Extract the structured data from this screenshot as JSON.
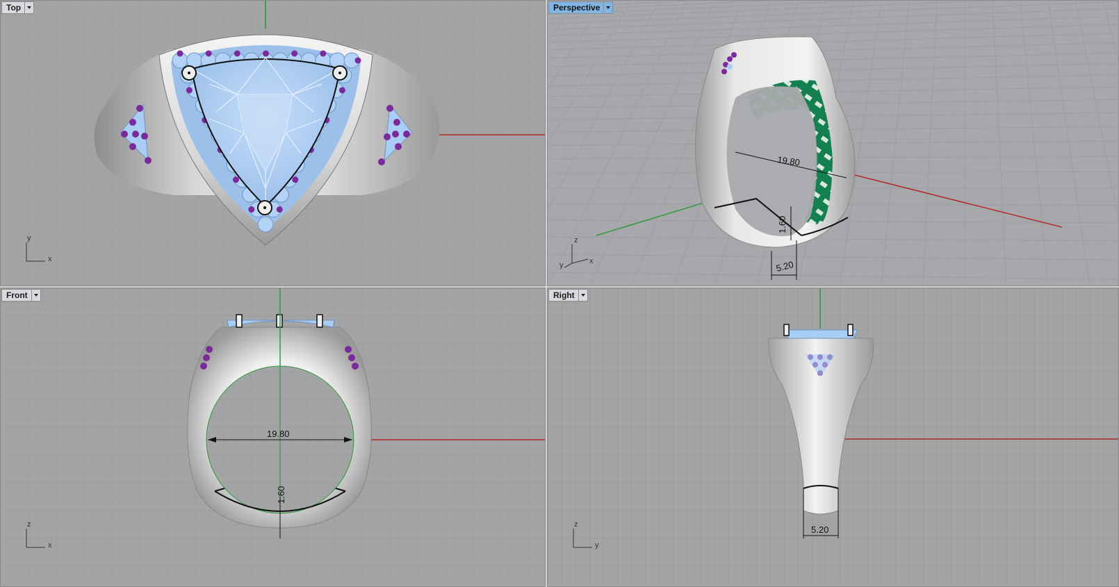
{
  "viewports": {
    "top": {
      "label": "Top",
      "axis_h": "x",
      "axis_v": "y"
    },
    "perspective": {
      "label": "Perspective",
      "axis_x": "x",
      "axis_y": "y",
      "axis_z": "z",
      "dim_diameter": "19.80",
      "dim_thickness": "1.60",
      "dim_width": "5.20"
    },
    "front": {
      "label": "Front",
      "axis_h": "x",
      "axis_v": "z",
      "dim_diameter": "19.80",
      "dim_thickness": "1.60"
    },
    "right": {
      "label": "Right",
      "axis_h": "y",
      "axis_v": "z",
      "dim_width": "5.20"
    }
  },
  "colors": {
    "viewport_bg": "#a3a4a6",
    "grid_line": "#959698",
    "axis_x": "#b22a26",
    "axis_y": "#2e9a3a",
    "metal": "#e6e6e6",
    "gem_blue": "#a9cdf5",
    "gem_purple": "#7a2a9a",
    "lattice_green": "#188a55",
    "active_tab": "#7fb6e6"
  }
}
